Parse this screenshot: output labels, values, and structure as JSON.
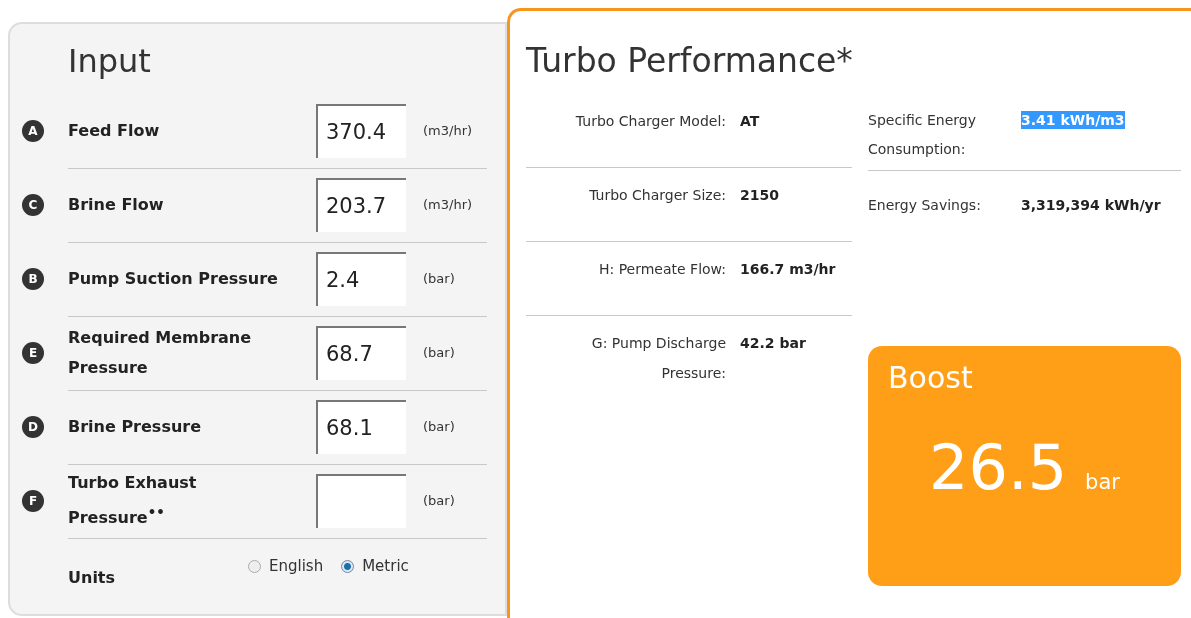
{
  "input": {
    "title": "Input",
    "fields": [
      {
        "badge": "A",
        "label": "Feed Flow",
        "value": "370.4",
        "unit": "(m3/hr)"
      },
      {
        "badge": "C",
        "label": "Brine Flow",
        "value": "203.7",
        "unit": "(m3/hr)"
      },
      {
        "badge": "B",
        "label": "Pump Suction Pressure",
        "value": "2.4",
        "unit": "(bar)"
      },
      {
        "badge": "E",
        "label": "Required Membrane Pressure",
        "value": "68.7",
        "unit": "(bar)"
      },
      {
        "badge": "D",
        "label": "Brine Pressure",
        "value": "68.1",
        "unit": "(bar)"
      },
      {
        "badge": "F",
        "label": "Turbo Exhaust Pressure$^{••}$",
        "unit": "(bar)"
      }
    ],
    "units": {
      "label": "Units",
      "options": [
        {
          "label": "English",
          "selected": false
        },
        {
          "label": "Metric",
          "selected": true
        }
      ]
    }
  },
  "performance": {
    "title": "Turbo Performance*",
    "left_rows": [
      {
        "label": "Turbo Charger Model:",
        "value": "AT"
      },
      {
        "label": "Turbo Charger Size:",
        "value": "2150"
      },
      {
        "label": "H: Permeate Flow:",
        "value": "166.7 m3/hr"
      },
      {
        "label": "G: Pump Discharge Pressure:",
        "value": "42.2 bar"
      }
    ],
    "right_rows": [
      {
        "label": "Specific Energy Consumption:",
        "value": "3.41 kWh/m3",
        "highlighted": true
      },
      {
        "label": "Energy Savings:",
        "value": "3,319,394 kWh/yr",
        "highlighted": false
      }
    ],
    "boost": {
      "title": "Boost",
      "value": "26.5",
      "unit": "bar"
    }
  }
}
